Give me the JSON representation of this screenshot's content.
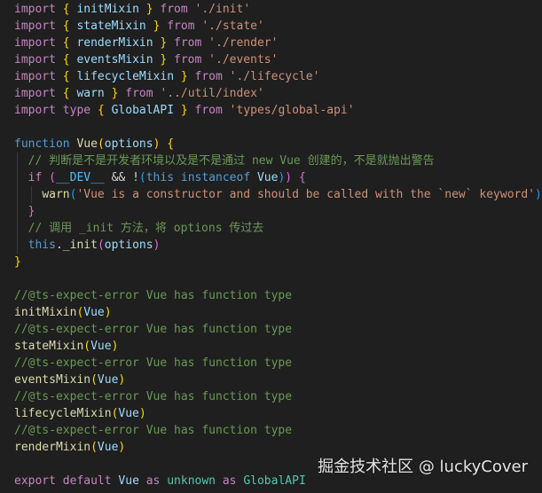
{
  "theme": {
    "background": "#1f1f1f",
    "default_text": "#d4d4d4",
    "colors": {
      "kw": "#c586c0",
      "dkw": "#569cd6",
      "fn": "#dcdcaa",
      "var": "#9cdcfe",
      "type": "#4ec9b0",
      "str": "#ce9178",
      "cmt": "#6a9955",
      "br1": "#ffd700",
      "br2": "#da70d6",
      "br3": "#179fff",
      "pl": "#d4d4d4",
      "const": "#4fc1ff"
    }
  },
  "editor": {
    "lines": [
      [
        [
          "import",
          "kw"
        ],
        [
          " ",
          "pl"
        ],
        [
          "{",
          "br1"
        ],
        [
          " ",
          "pl"
        ],
        [
          "initMixin",
          "var"
        ],
        [
          " ",
          "pl"
        ],
        [
          "}",
          "br1"
        ],
        [
          " ",
          "pl"
        ],
        [
          "from",
          "kw"
        ],
        [
          " ",
          "pl"
        ],
        [
          "'./init'",
          "str"
        ]
      ],
      [
        [
          "import",
          "kw"
        ],
        [
          " ",
          "pl"
        ],
        [
          "{",
          "br1"
        ],
        [
          " ",
          "pl"
        ],
        [
          "stateMixin",
          "var"
        ],
        [
          " ",
          "pl"
        ],
        [
          "}",
          "br1"
        ],
        [
          " ",
          "pl"
        ],
        [
          "from",
          "kw"
        ],
        [
          " ",
          "pl"
        ],
        [
          "'./state'",
          "str"
        ]
      ],
      [
        [
          "import",
          "kw"
        ],
        [
          " ",
          "pl"
        ],
        [
          "{",
          "br1"
        ],
        [
          " ",
          "pl"
        ],
        [
          "renderMixin",
          "var"
        ],
        [
          " ",
          "pl"
        ],
        [
          "}",
          "br1"
        ],
        [
          " ",
          "pl"
        ],
        [
          "from",
          "kw"
        ],
        [
          " ",
          "pl"
        ],
        [
          "'./render'",
          "str"
        ]
      ],
      [
        [
          "import",
          "kw"
        ],
        [
          " ",
          "pl"
        ],
        [
          "{",
          "br1"
        ],
        [
          " ",
          "pl"
        ],
        [
          "eventsMixin",
          "var"
        ],
        [
          " ",
          "pl"
        ],
        [
          "}",
          "br1"
        ],
        [
          " ",
          "pl"
        ],
        [
          "from",
          "kw"
        ],
        [
          " ",
          "pl"
        ],
        [
          "'./events'",
          "str"
        ]
      ],
      [
        [
          "import",
          "kw"
        ],
        [
          " ",
          "pl"
        ],
        [
          "{",
          "br1"
        ],
        [
          " ",
          "pl"
        ],
        [
          "lifecycleMixin",
          "var"
        ],
        [
          " ",
          "pl"
        ],
        [
          "}",
          "br1"
        ],
        [
          " ",
          "pl"
        ],
        [
          "from",
          "kw"
        ],
        [
          " ",
          "pl"
        ],
        [
          "'./lifecycle'",
          "str"
        ]
      ],
      [
        [
          "import",
          "kw"
        ],
        [
          " ",
          "pl"
        ],
        [
          "{",
          "br1"
        ],
        [
          " ",
          "pl"
        ],
        [
          "warn",
          "var"
        ],
        [
          " ",
          "pl"
        ],
        [
          "}",
          "br1"
        ],
        [
          " ",
          "pl"
        ],
        [
          "from",
          "kw"
        ],
        [
          " ",
          "pl"
        ],
        [
          "'../util/index'",
          "str"
        ]
      ],
      [
        [
          "import",
          "kw"
        ],
        [
          " ",
          "pl"
        ],
        [
          "type",
          "kw"
        ],
        [
          " ",
          "pl"
        ],
        [
          "{",
          "br1"
        ],
        [
          " ",
          "pl"
        ],
        [
          "GlobalAPI",
          "var"
        ],
        [
          " ",
          "pl"
        ],
        [
          "}",
          "br1"
        ],
        [
          " ",
          "pl"
        ],
        [
          "from",
          "kw"
        ],
        [
          " ",
          "pl"
        ],
        [
          "'types/global-api'",
          "str"
        ]
      ],
      [],
      [
        [
          "function",
          "dkw"
        ],
        [
          " ",
          "pl"
        ],
        [
          "Vue",
          "fn"
        ],
        [
          "(",
          "br1"
        ],
        [
          "options",
          "var"
        ],
        [
          ")",
          "br1"
        ],
        [
          " ",
          "pl"
        ],
        [
          "{",
          "br1"
        ]
      ],
      [
        [
          "  ",
          "pl"
        ],
        [
          "// 判断是不是开发者环境以及是不是通过 new Vue 创建的，不是就抛出警告",
          "cmt"
        ]
      ],
      [
        [
          "  ",
          "pl"
        ],
        [
          "if",
          "kw"
        ],
        [
          " ",
          "pl"
        ],
        [
          "(",
          "br2"
        ],
        [
          "__DEV__",
          "const"
        ],
        [
          " ",
          "pl"
        ],
        [
          "&&",
          "pl"
        ],
        [
          " ",
          "pl"
        ],
        [
          "!",
          "pl"
        ],
        [
          "(",
          "br3"
        ],
        [
          "this",
          "dkw"
        ],
        [
          " ",
          "pl"
        ],
        [
          "instanceof",
          "dkw"
        ],
        [
          " ",
          "pl"
        ],
        [
          "Vue",
          "var"
        ],
        [
          ")",
          "br3"
        ],
        [
          ")",
          "br2"
        ],
        [
          " ",
          "pl"
        ],
        [
          "{",
          "br2"
        ]
      ],
      [
        [
          "    ",
          "pl"
        ],
        [
          "warn",
          "fn"
        ],
        [
          "(",
          "br3"
        ],
        [
          "'Vue is a constructor and should be called with the `new` keyword'",
          "str"
        ],
        [
          ")",
          "br3"
        ]
      ],
      [
        [
          "  ",
          "pl"
        ],
        [
          "}",
          "br2"
        ]
      ],
      [
        [
          "  ",
          "pl"
        ],
        [
          "// 调用 _init 方法，将 options 传过去",
          "cmt"
        ]
      ],
      [
        [
          "  ",
          "pl"
        ],
        [
          "this",
          "dkw"
        ],
        [
          ".",
          "pl"
        ],
        [
          "_init",
          "fn"
        ],
        [
          "(",
          "br2"
        ],
        [
          "options",
          "var"
        ],
        [
          ")",
          "br2"
        ]
      ],
      [
        [
          "}",
          "br1"
        ]
      ],
      [],
      [
        [
          "//@ts-expect-error Vue has function type",
          "cmt"
        ]
      ],
      [
        [
          "initMixin",
          "fn"
        ],
        [
          "(",
          "br1"
        ],
        [
          "Vue",
          "var"
        ],
        [
          ")",
          "br1"
        ]
      ],
      [
        [
          "//@ts-expect-error Vue has function type",
          "cmt"
        ]
      ],
      [
        [
          "stateMixin",
          "fn"
        ],
        [
          "(",
          "br1"
        ],
        [
          "Vue",
          "var"
        ],
        [
          ")",
          "br1"
        ]
      ],
      [
        [
          "//@ts-expect-error Vue has function type",
          "cmt"
        ]
      ],
      [
        [
          "eventsMixin",
          "fn"
        ],
        [
          "(",
          "br1"
        ],
        [
          "Vue",
          "var"
        ],
        [
          ")",
          "br1"
        ]
      ],
      [
        [
          "//@ts-expect-error Vue has function type",
          "cmt"
        ]
      ],
      [
        [
          "lifecycleMixin",
          "fn"
        ],
        [
          "(",
          "br1"
        ],
        [
          "Vue",
          "var"
        ],
        [
          ")",
          "br1"
        ]
      ],
      [
        [
          "//@ts-expect-error Vue has function type",
          "cmt"
        ]
      ],
      [
        [
          "renderMixin",
          "fn"
        ],
        [
          "(",
          "br1"
        ],
        [
          "Vue",
          "var"
        ],
        [
          ")",
          "br1"
        ]
      ],
      [],
      [
        [
          "export",
          "kw"
        ],
        [
          " ",
          "pl"
        ],
        [
          "default",
          "kw"
        ],
        [
          " ",
          "pl"
        ],
        [
          "Vue",
          "var"
        ],
        [
          " ",
          "pl"
        ],
        [
          "as",
          "kw"
        ],
        [
          " ",
          "pl"
        ],
        [
          "unknown",
          "type"
        ],
        [
          " ",
          "pl"
        ],
        [
          "as",
          "kw"
        ],
        [
          " ",
          "pl"
        ],
        [
          "GlobalAPI",
          "type"
        ]
      ]
    ]
  },
  "watermark": {
    "text": "掘金技术社区 @ luckyCover"
  }
}
